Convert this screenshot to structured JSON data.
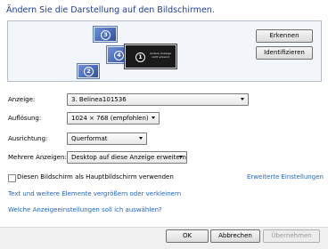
{
  "heading": "Ändern Sie die Darstellung auf den Bildschirmen.",
  "monitors": [
    {
      "number": "3"
    },
    {
      "number": "4"
    },
    {
      "number": "1",
      "preview_text": "Andere Anzeige nicht erkannt"
    },
    {
      "number": "2"
    }
  ],
  "buttons": {
    "detect": "Erkennen",
    "identify": "Identifizieren",
    "ok": "OK",
    "cancel": "Abbrechen",
    "apply": "Übernehmen"
  },
  "settings": {
    "display_label": "Anzeige:",
    "display_value": "3. Belinea101536",
    "resolution_label": "Auflösung:",
    "resolution_value": "1024 × 768 (empfohlen)",
    "orientation_label": "Ausrichtung:",
    "orientation_value": "Querformat",
    "multiple_label": "Mehrere Anzeigen:",
    "multiple_value": "Desktop auf diese Anzeige erweitern"
  },
  "main_display_checkbox": {
    "label": "Diesen Bildschirm als Hauptbildschirm verwenden",
    "checked": false
  },
  "links": {
    "advanced": "Erweiterte Einstellungen",
    "text_size": "Text und weitere Elemente vergrößern oder verkleinern",
    "which_settings": "Welche Anzeigeeinstellungen soll ich auswählen?"
  },
  "colors": {
    "heading": "#1e3c96",
    "link": "#1e64c8",
    "monitor_blue": "#4a6cc0",
    "selected_monitor": "#1a1a1a"
  }
}
